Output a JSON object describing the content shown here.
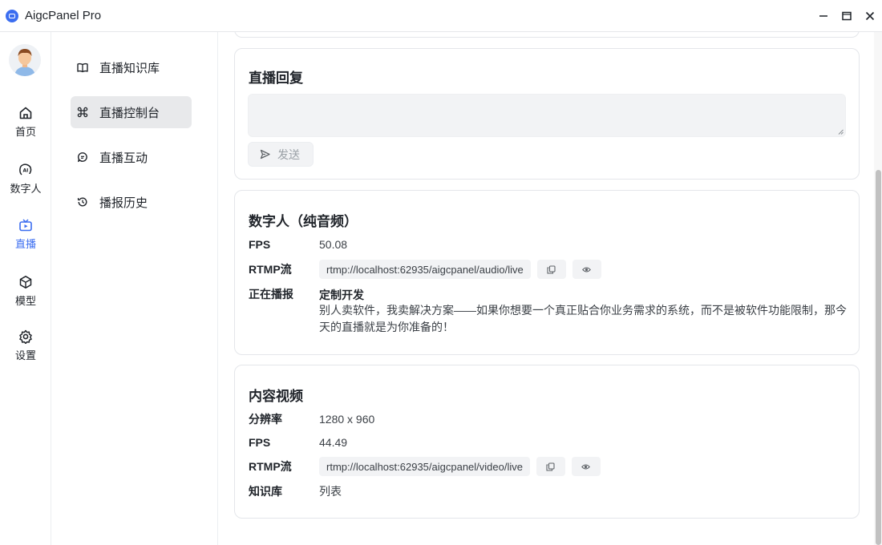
{
  "window": {
    "title": "AigcPanel Pro",
    "controls": [
      "minimize-icon",
      "maximize-icon",
      "close-icon"
    ]
  },
  "rail": {
    "items": [
      {
        "label": "首页",
        "icon": "home-icon"
      },
      {
        "label": "数字人",
        "icon": "ai-face-icon"
      },
      {
        "label": "直播",
        "icon": "tv-icon",
        "active": true
      },
      {
        "label": "模型",
        "icon": "cube-icon"
      },
      {
        "label": "设置",
        "icon": "gear-icon"
      }
    ],
    "accent": "#3b6df0"
  },
  "submenu": {
    "items": [
      {
        "label": "直播知识库",
        "icon": "book-icon"
      },
      {
        "label": "直播控制台",
        "icon": "command-icon",
        "active": true
      },
      {
        "label": "直播互动",
        "icon": "chat-icon"
      },
      {
        "label": "播报历史",
        "icon": "history-icon"
      }
    ]
  },
  "reply": {
    "title": "直播回复",
    "input_value": "",
    "send_label": "发送"
  },
  "digital_human": {
    "title": "数字人（纯音频）",
    "fps_label": "FPS",
    "fps_value": "50.08",
    "rtmp_label": "RTMP流",
    "rtmp_value": "rtmp://localhost:62935/aigcpanel/audio/live",
    "playing_label": "正在播报",
    "playing_title": "定制开发",
    "playing_text": "别人卖软件，我卖解决方案——如果你想要一个真正贴合你业务需求的系统，而不是被软件功能限制，那今天的直播就是为你准备的！"
  },
  "content_video": {
    "title": "内容视频",
    "resolution_label": "分辨率",
    "resolution_value": "1280 x 960",
    "fps_label": "FPS",
    "fps_value": "44.49",
    "rtmp_label": "RTMP流",
    "rtmp_value": "rtmp://localhost:62935/aigcpanel/video/live",
    "kb_label": "知识库",
    "kb_value": "列表"
  }
}
